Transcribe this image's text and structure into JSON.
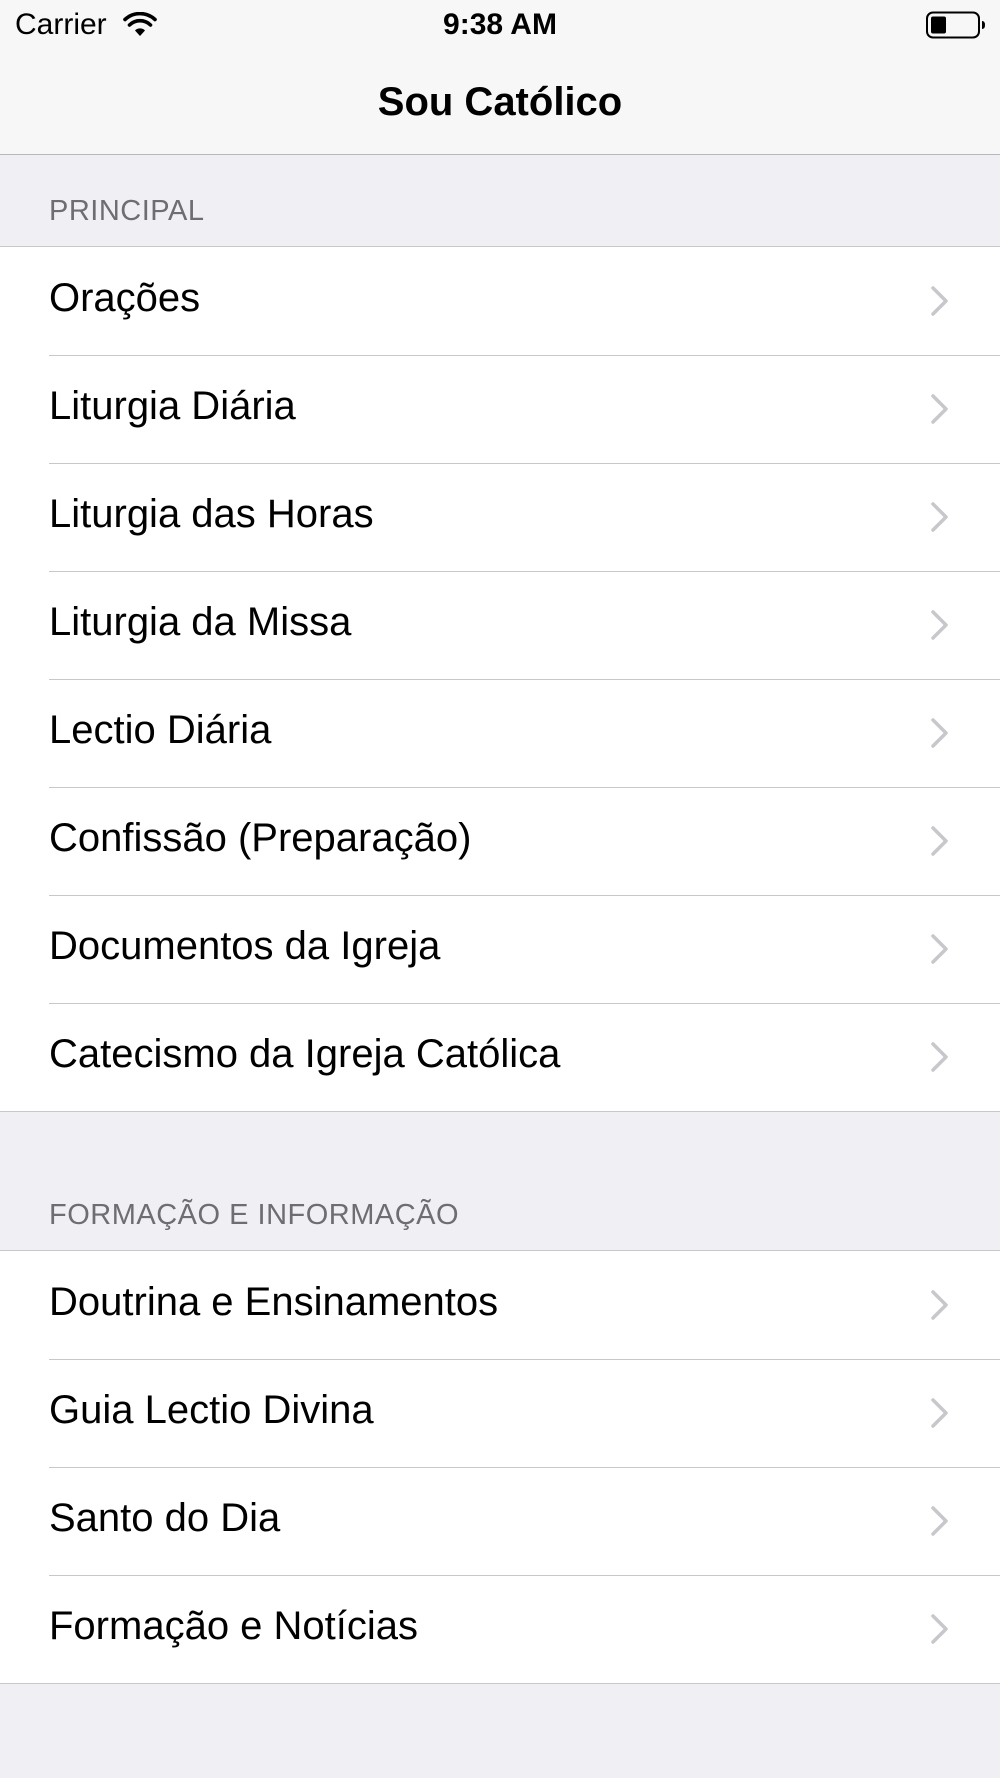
{
  "status_bar": {
    "carrier": "Carrier",
    "time": "9:38 AM",
    "wifi_icon": "wifi-icon",
    "battery_icon": "battery-icon"
  },
  "nav": {
    "title": "Sou Católico"
  },
  "sections": [
    {
      "header": "PRINCIPAL",
      "items": [
        {
          "label": "Orações"
        },
        {
          "label": "Liturgia Diária"
        },
        {
          "label": "Liturgia das Horas"
        },
        {
          "label": "Liturgia da Missa"
        },
        {
          "label": "Lectio Diária"
        },
        {
          "label": "Confissão (Preparação)"
        },
        {
          "label": "Documentos da Igreja"
        },
        {
          "label": "Catecismo da Igreja Católica"
        }
      ]
    },
    {
      "header": "FORMAÇÃO E INFORMAÇÃO",
      "items": [
        {
          "label": "Doutrina e Ensinamentos"
        },
        {
          "label": "Guia Lectio Divina"
        },
        {
          "label": "Santo do Dia"
        },
        {
          "label": "Formação e Notícias"
        }
      ]
    }
  ],
  "colors": {
    "background": "#efeff4",
    "separator": "#c8c7cc",
    "chevron": "#c7c7cc",
    "section_header_text": "#6d6d72"
  }
}
